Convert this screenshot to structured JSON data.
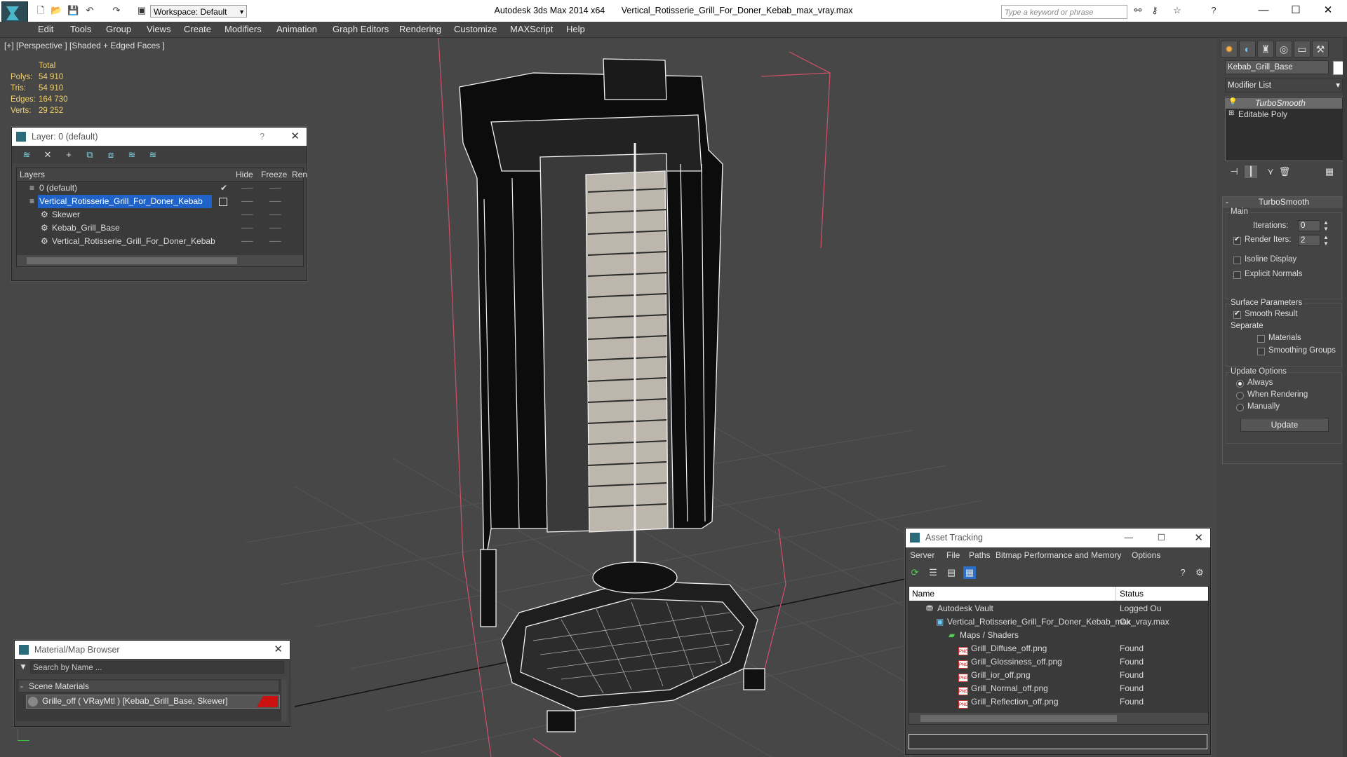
{
  "app": {
    "title_app": "Autodesk 3ds Max  2014 x64",
    "title_file": "Vertical_Rotisserie_Grill_For_Doner_Kebab_max_vray.max",
    "workspace": "Workspace: Default",
    "search_placeholder": "Type a keyword or phrase"
  },
  "menu": [
    "Edit",
    "Tools",
    "Group",
    "Views",
    "Create",
    "Modifiers",
    "Animation",
    "Graph Editors",
    "Rendering",
    "Customize",
    "MAXScript",
    "Help"
  ],
  "viewport": {
    "label": "[+] [Perspective ] [Shaded + Edged Faces ]",
    "stats": {
      "header": "Total",
      "rows": [
        {
          "label": "Polys:",
          "value": "54 910"
        },
        {
          "label": "Tris:",
          "value": "54 910"
        },
        {
          "label": "Edges:",
          "value": "164 730"
        },
        {
          "label": "Verts:",
          "value": "29 252"
        }
      ]
    }
  },
  "layer_panel": {
    "title": "Layer: 0 (default)",
    "help": "?",
    "columns": {
      "layers": "Layers",
      "hide": "Hide",
      "freeze": "Freeze",
      "render": "Ren"
    },
    "rows": [
      {
        "name": "0 (default)",
        "indent": 1,
        "selected": false
      },
      {
        "name": "Vertical_Rotisserie_Grill_For_Doner_Kebab",
        "indent": 1,
        "selected": true
      },
      {
        "name": "Skewer",
        "indent": 2,
        "selected": false
      },
      {
        "name": "Kebab_Grill_Base",
        "indent": 2,
        "selected": false
      },
      {
        "name": "Vertical_Rotisserie_Grill_For_Doner_Kebab",
        "indent": 2,
        "selected": false
      }
    ]
  },
  "material_browser": {
    "title": "Material/Map Browser",
    "search_placeholder": "Search by Name ...",
    "section": "Scene Materials",
    "item": "Grille_off  ( VRayMtl ) [Kebab_Grill_Base, Skewer]"
  },
  "asset_tracking": {
    "title": "Asset Tracking",
    "menu": [
      "Server",
      "File",
      "Paths",
      "Bitmap Performance and Memory",
      "Options"
    ],
    "columns": {
      "name": "Name",
      "status": "Status"
    },
    "rows": [
      {
        "name": "Autodesk Vault",
        "status": "Logged Ou",
        "type": "vault"
      },
      {
        "name": "Vertical_Rotisserie_Grill_For_Doner_Kebab_max_vray.max",
        "status": "Ok",
        "type": "max"
      },
      {
        "name": "Maps / Shaders",
        "status": "",
        "type": "folder"
      },
      {
        "name": "Grill_Diffuse_off.png",
        "status": "Found",
        "type": "png"
      },
      {
        "name": "Grill_Glossiness_off.png",
        "status": "Found",
        "type": "png"
      },
      {
        "name": "Grill_ior_off.png",
        "status": "Found",
        "type": "png"
      },
      {
        "name": "Grill_Normal_off.png",
        "status": "Found",
        "type": "png"
      },
      {
        "name": "Grill_Reflection_off.png",
        "status": "Found",
        "type": "png"
      }
    ]
  },
  "command_panel": {
    "object_name": "Kebab_Grill_Base",
    "modifier_list": "Modifier List",
    "stack": [
      "TurboSmooth",
      "Editable Poly"
    ],
    "rollout_title": "TurboSmooth",
    "main_label": "Main",
    "iterations_label": "Iterations:",
    "iterations_value": "0",
    "render_iters_label": "Render Iters:",
    "render_iters_value": "2",
    "isoline": "Isoline Display",
    "explicit": "Explicit Normals",
    "surface_params": "Surface Parameters",
    "smooth_result": "Smooth Result",
    "separate": "Separate",
    "materials": "Materials",
    "smoothing_groups": "Smoothing Groups",
    "update_options": "Update Options",
    "always": "Always",
    "when_rendering": "When Rendering",
    "manually": "Manually",
    "update_button": "Update",
    "collapse": "-"
  },
  "colors": {
    "selection": "#1f63c9",
    "stats": "#f0d070",
    "viewport_bg": "#474747",
    "material_swatch": "#cc1111"
  }
}
